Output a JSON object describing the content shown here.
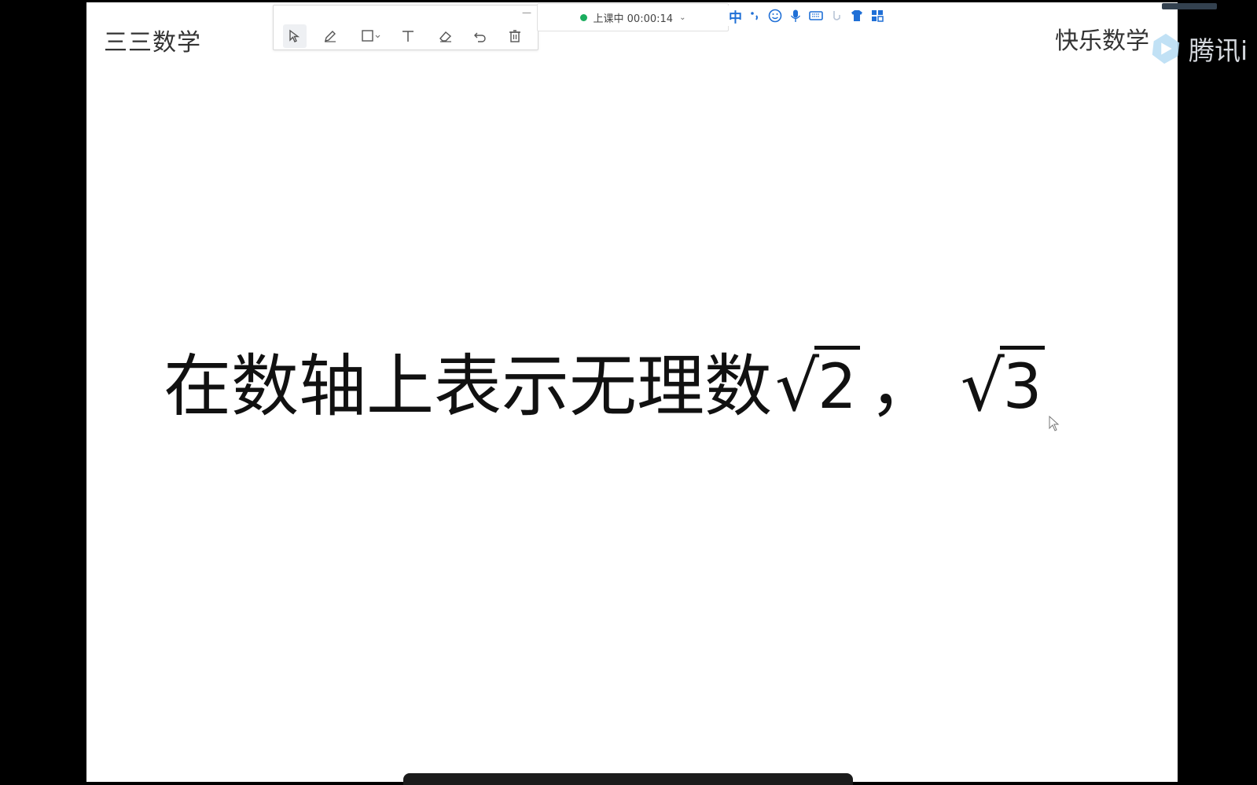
{
  "slide": {
    "corner_left": "三三数学",
    "corner_right": "快乐数学",
    "headline": {
      "text": "在数轴上表示无理数",
      "radical_sign": "√",
      "first_radicand": "2",
      "separator": "，",
      "second_radicand": "3"
    }
  },
  "toolbar": {
    "minimize_label": "—",
    "tools": [
      "select-tool",
      "pen-tool",
      "shape-tool",
      "text-tool",
      "eraser-tool",
      "undo-tool",
      "delete-tool"
    ]
  },
  "status": {
    "label": "上课中 00:00:14",
    "indicator_color": "#1aad5e"
  },
  "ime": {
    "mode": "中",
    "icons": [
      "punctuation-icon",
      "emoji-icon",
      "microphone-icon",
      "keyboard-icon",
      "handwriting-icon",
      "skin-icon",
      "toolbox-icon"
    ],
    "accent_color": "#1f6fd6"
  },
  "app": {
    "logo_text": "腾讯i"
  }
}
